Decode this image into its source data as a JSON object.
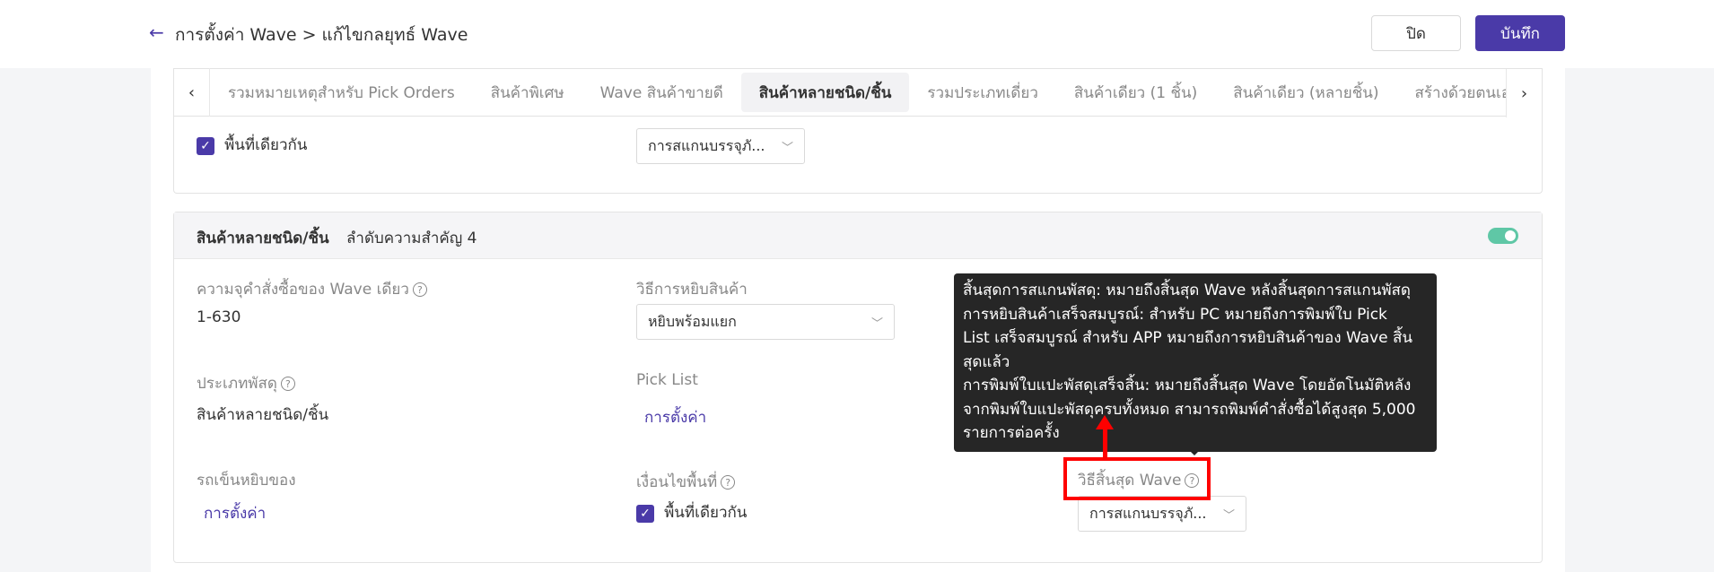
{
  "header": {
    "title": "การตั้งค่า Wave > แก้ไขกลยุทธ์ Wave",
    "close_label": "ปิด",
    "save_label": "บันทึก"
  },
  "tabs": [
    "รวมหมายเหตุสำหรับ Pick Orders",
    "สินค้าพิเศษ",
    "Wave สินค้าขายดี",
    "สินค้าหลายชนิด/ชิ้น",
    "รวมประเภทเดี่ยว",
    "สินค้าเดียว (1 ชิ้น)",
    "สินค้าเดียว (หลายชิ้น)",
    "สร้างด้วยตนเอง"
  ],
  "active_tab": "สินค้าหลายชนิด/ชิ้น",
  "card1": {
    "checkbox_label": "พื้นที่เดียวกัน",
    "select_value": "การสแกนบรรจุภั..."
  },
  "card2": {
    "title": "สินค้าหลายชนิด/ชิ้น",
    "priority": "ลำดับความสำคัญ 4",
    "order_capacity_label": "ความจุคำสั่งซื้อของ Wave เดียว",
    "order_capacity_value": "1-630",
    "picking_method_label": "วิธีการหยิบสินค้า",
    "picking_method_value": "หยิบพร้อมแยก",
    "package_type_label": "ประเภทพัสดุ",
    "package_type_value": "สินค้าหลายชนิด/ชิ้น",
    "pick_list_label": "Pick List",
    "pick_list_link": "การตั้งค่า",
    "cart_label": "รถเข็นหยิบของ",
    "cart_link": "การตั้งค่า",
    "area_condition_label": "เงื่อนไขพื้นที่",
    "area_checkbox_label": "พื้นที่เดียวกัน",
    "wave_end_label": "วิธีสิ้นสุด Wave",
    "wave_end_value": "การสแกนบรรจุภั..."
  },
  "tooltip": {
    "lines": [
      "สิ้นสุดการสแกนพัสดุ: หมายถึงสิ้นสุด Wave หลังสิ้นสุดการสแกนพัสดุ",
      "การหยิบสินค้าเสร็จสมบูรณ์: สำหรับ PC หมายถึงการพิมพ์ใบ Pick",
      "List เสร็จสมบูรณ์ สำหรับ APP หมายถึงการหยิบสินค้าของ Wave สิ้น",
      "สุดแล้ว",
      "การพิมพ์ใบแปะพัสดุเสร็จสิ้น: หมายถึงสิ้นสุด Wave โดยอัตโนมัติหลัง",
      "จากพิมพ์ใบแปะพัสดุครบทั้งหมด สามารถพิมพ์คำสั่งซื้อได้สูงสุด 5,000",
      "รายการต่อครั้ง"
    ]
  },
  "colors": {
    "brand": "#4a3aa8",
    "toggle_on": "#5fc7a6",
    "tooltip_bg": "#262626",
    "annotation": "#ff0000"
  }
}
